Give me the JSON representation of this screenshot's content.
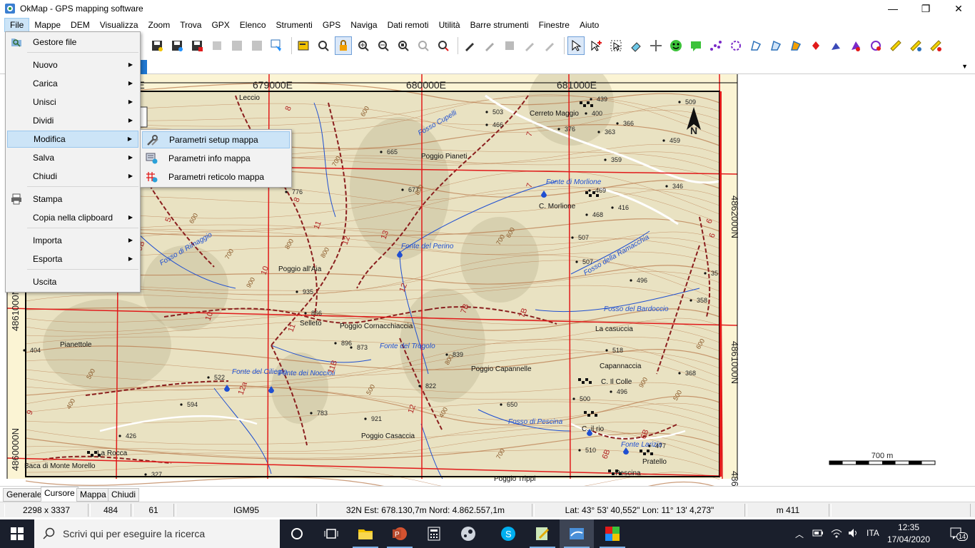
{
  "window": {
    "title": "OkMap - GPS mapping software",
    "minimize_glyph": "—",
    "restore_glyph": "❐",
    "close_glyph": "✕"
  },
  "menubar": {
    "items": [
      "File",
      "Mappe",
      "DEM",
      "Visualizza",
      "Zoom",
      "Trova",
      "GPX",
      "Elenco",
      "Strumenti",
      "GPS",
      "Naviga",
      "Dati remoti",
      "Utilità",
      "Barre strumenti",
      "Finestre",
      "Aiuto"
    ],
    "active": "File"
  },
  "file_menu": {
    "items": [
      {
        "label": "Gestore file",
        "icon": "folder-search-icon",
        "submenu": false
      },
      {
        "label": "Nuovo",
        "submenu": true
      },
      {
        "label": "Carica",
        "submenu": true
      },
      {
        "label": "Unisci",
        "submenu": true
      },
      {
        "label": "Dividi",
        "submenu": true
      },
      {
        "label": "Modifica",
        "submenu": true,
        "highlighted": true
      },
      {
        "label": "Salva",
        "submenu": true
      },
      {
        "label": "Chiudi",
        "submenu": true
      },
      {
        "label": "Stampa",
        "icon": "printer-icon",
        "submenu": false
      },
      {
        "label": "Copia nella clipboard",
        "submenu": true
      },
      {
        "label": "Importa",
        "submenu": true
      },
      {
        "label": "Esporta",
        "submenu": true
      },
      {
        "label": "Uscita",
        "submenu": false
      }
    ],
    "arrow_glyph": "▶"
  },
  "modifica_submenu": {
    "items": [
      {
        "label": "Parametri setup mappa",
        "icon": "tools-icon",
        "highlighted": true
      },
      {
        "label": "Parametri info mappa",
        "icon": "map-info-icon"
      },
      {
        "label": "Parametri reticolo mappa",
        "icon": "grid-icon"
      }
    ]
  },
  "map": {
    "top_labels": [
      "E",
      "679000E",
      "680000E",
      "681000E"
    ],
    "right_labels": [
      "4862000N",
      "4861000N",
      "4860"
    ],
    "left_labels": [
      "4861000N",
      "4860000N"
    ],
    "north_label": "N",
    "scale_label": "700 m",
    "place_names": [
      "Leccio",
      "Cerreto Maggio",
      "Poggio Pianeti",
      "Fonte di Morlione",
      "C. Morlione",
      "Fosso Cupelli",
      "Fonte del Perino",
      "Fosso di Rimaggio",
      "Poggio all'Aia",
      "Fosso della Ramacchia",
      "Fosso del Bardoccio",
      "Selleto",
      "Poggio Cornacchiaccia",
      "Pianettole",
      "Fonte del Trogolo",
      "Poggio Capannelle",
      "La casuccia",
      "Capannaccia",
      "C. Il Colle",
      "Fonte del Ciliegio",
      "Fonte dei Noccioli",
      "Poggio Casaccia",
      "Fosso di Pescina",
      "C. il rio",
      "La Rocca",
      "Pratello",
      "Fonte Larizia",
      "Pescina",
      "Poggio Trippi",
      "Baca di Monte Morello"
    ],
    "elevations": [
      "503",
      "466",
      "376",
      "439",
      "400",
      "363",
      "366",
      "509",
      "459",
      "665",
      "677",
      "776",
      "359",
      "469",
      "468",
      "416",
      "346",
      "507",
      "507",
      "496",
      "935",
      "866",
      "896",
      "873",
      "839",
      "822",
      "404",
      "522",
      "594",
      "650",
      "921",
      "783",
      "426",
      "327",
      "518",
      "500",
      "496",
      "510",
      "477",
      "368",
      "358",
      "35"
    ],
    "trail_numbers": [
      "8",
      "8",
      "7",
      "7",
      "6",
      "11",
      "12",
      "13",
      "9",
      "9B",
      "10",
      "11",
      "12",
      "7B",
      "7B",
      "11B",
      "12",
      "12a",
      "6B",
      "6B",
      "9",
      "10",
      "6",
      "5"
    ],
    "contour_labels": [
      "600",
      "700",
      "800",
      "900",
      "600",
      "700",
      "800",
      "500",
      "400",
      "900",
      "800",
      "700",
      "600",
      "500",
      "400",
      "800",
      "600",
      "700",
      "500"
    ]
  },
  "bottom_tabs": {
    "items": [
      "Generale",
      "Cursore",
      "Mappa",
      "Chiudi"
    ],
    "active": "Cursore"
  },
  "status": {
    "size": "2298 x 3337",
    "val1": "484",
    "val2": "61",
    "datum": "IGM95",
    "utm": "32N  Est: 678.130,7m  Nord: 4.862.557,1m",
    "latlon": "Lat: 43° 53' 40,552\"  Lon: 11° 13' 4,273\"",
    "elev": "m 411"
  },
  "taskbar": {
    "search_placeholder": "Scrivi qui per eseguire la ricerca",
    "language": "ITA",
    "time": "12:35",
    "date": "17/04/2020",
    "notifications": "14"
  },
  "colors": {
    "accent": "#1f77d0",
    "menu_highlight": "#cce4f7",
    "grid_line": "#e11a1a",
    "trail": "#8a1e1e",
    "contour": "#b97b4e",
    "water": "#1f4fd1",
    "map_bg": "#e9e2c2",
    "taskbar": "#1a1f2c"
  }
}
